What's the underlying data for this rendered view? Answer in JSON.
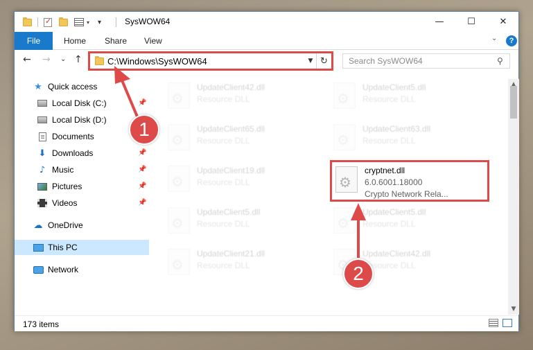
{
  "window": {
    "title": "SysWOW64"
  },
  "titlebar": {
    "minimize": "—",
    "maximize": "☐",
    "close": "✕"
  },
  "ribbon": {
    "tabs": [
      "File",
      "Home",
      "Share",
      "View"
    ],
    "help": "?"
  },
  "navbar": {
    "back": "←",
    "forward": "→",
    "recent": "⌄",
    "up": "↑",
    "address": "C:\\Windows\\SysWOW64",
    "address_drop": "▼",
    "refresh": "↻",
    "search_placeholder": "Search SysWOW64",
    "search_icon": "⚲"
  },
  "sidebar": {
    "items": [
      {
        "label": "Quick access",
        "icon": "star-icon",
        "pinned": false
      },
      {
        "label": "Local Disk (C:)",
        "icon": "drive-icon",
        "pinned": true
      },
      {
        "label": "Local Disk (D:)",
        "icon": "drive-icon",
        "pinned": false
      },
      {
        "label": "Documents",
        "icon": "documents-icon",
        "pinned": true
      },
      {
        "label": "Downloads",
        "icon": "downloads-icon",
        "pinned": true
      },
      {
        "label": "Music",
        "icon": "music-icon",
        "pinned": true
      },
      {
        "label": "Pictures",
        "icon": "pictures-icon",
        "pinned": true
      },
      {
        "label": "Videos",
        "icon": "videos-icon",
        "pinned": true
      },
      {
        "label": "OneDrive",
        "icon": "onedrive-icon",
        "pinned": false
      },
      {
        "label": "This PC",
        "icon": "this-pc-icon",
        "pinned": false,
        "selected": true
      },
      {
        "label": "Network",
        "icon": "network-icon",
        "pinned": false
      }
    ],
    "pin_glyph": "📌"
  },
  "files": [
    {
      "name": "UpdateClient42.dll",
      "type": "Resource DLL"
    },
    {
      "name": "UpdateClient5.dll",
      "type": "Resource DLL"
    },
    {
      "name": "UpdateClient65.dll",
      "type": "Resource DLL"
    },
    {
      "name": "UpdateClient63.dll",
      "type": "Resource DLL"
    },
    {
      "name": "UpdateClient19.dll",
      "type": "Resource DLL"
    },
    {
      "name": "cryptnet.dll",
      "version": "6.0.6001.18000",
      "type": "Crypto Network Rela..."
    },
    {
      "name": "UpdateClient5.dll",
      "type": "Resource DLL"
    },
    {
      "name": "UpdateClient5.dll",
      "type": "Resource DLL"
    },
    {
      "name": "UpdateClient21.dll",
      "type": "Resource DLL"
    },
    {
      "name": "UpdateClient42.dll",
      "type": "Resource DLL"
    }
  ],
  "status": {
    "item_count": "173 items"
  },
  "annotations": {
    "step1": "1",
    "step2": "2",
    "accent": "#dd4a4a"
  }
}
